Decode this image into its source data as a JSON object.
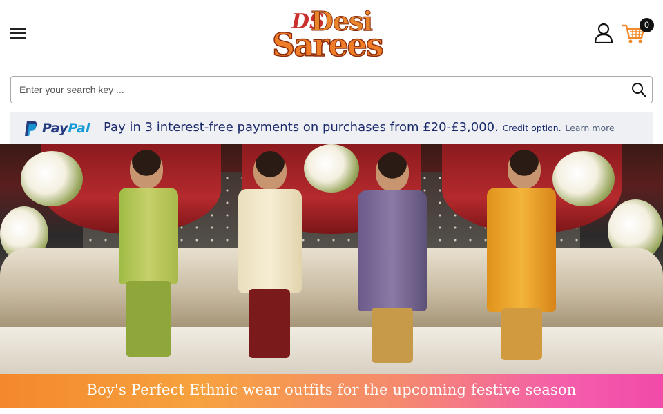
{
  "header": {
    "menu_icon": "hamburger-menu-icon",
    "logo": {
      "line1": "Desi",
      "line2": "Sarees",
      "mark": "DS"
    },
    "user_icon": "user-account-icon",
    "cart": {
      "icon": "shopping-cart-icon",
      "count": "0"
    }
  },
  "search": {
    "placeholder": "Enter your search key ...",
    "value": "",
    "icon": "search-icon"
  },
  "paypal": {
    "brand_a": "Pay",
    "brand_b": "Pal",
    "message": "Pay in 3 interest-free payments on purchases from £20-£3,000.",
    "credit_link": "Credit option.",
    "learn_more": "Learn more"
  },
  "hero": {
    "caption": "Boy's Perfect Ethnic wear outfits for the upcoming festive season"
  },
  "colors": {
    "accent_orange": "#ef7d27",
    "paypal_navy": "#253b80",
    "paypal_blue": "#179bd7",
    "banner_pink": "#f24aa9"
  }
}
